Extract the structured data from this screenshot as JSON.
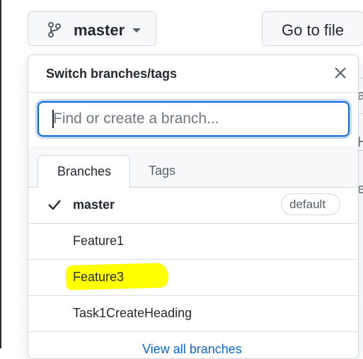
{
  "toolbar": {
    "branch_label": "master",
    "goto_label": "Go to file"
  },
  "dropdown": {
    "title": "Switch branches/tags",
    "search_placeholder": "Find or create a branch...",
    "tabs": [
      {
        "label": "Branches",
        "selected": true
      },
      {
        "label": "Tags",
        "selected": false
      }
    ],
    "branches": [
      {
        "name": "master",
        "current": true,
        "badge": "default"
      },
      {
        "name": "Feature1",
        "current": false
      },
      {
        "name": "Feature3",
        "current": false,
        "highlighted": true
      },
      {
        "name": "Task1CreateHeading",
        "current": false
      }
    ],
    "view_all_label": "View all branches"
  },
  "background_fragments": [
    "a",
    "H",
    "e"
  ],
  "colors": {
    "accent": "#0969da",
    "highlight": "#ffff00",
    "border": "#d0d7de"
  },
  "icons": {
    "branch": "git-branch-icon",
    "caret": "caret-down-icon",
    "close": "close-icon",
    "check": "check-icon"
  }
}
